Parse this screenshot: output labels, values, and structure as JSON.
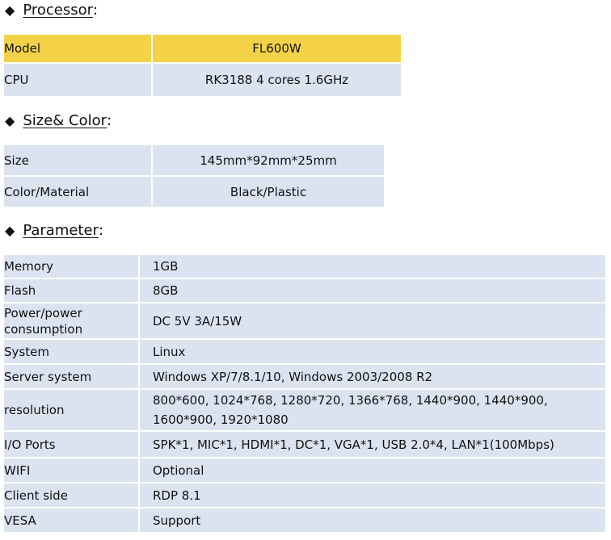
{
  "sections": {
    "processor": {
      "title": "Processor",
      "colon": ":"
    },
    "size_color": {
      "title": "Size& Color",
      "colon": ":"
    },
    "parameter": {
      "title": "Parameter",
      "colon": ":"
    }
  },
  "bullet": "◆",
  "processor_rows": [
    {
      "key": "Model",
      "value": "FL600W"
    },
    {
      "key": "CPU",
      "value": "RK3188 4 cores 1.6GHz"
    }
  ],
  "size_rows": [
    {
      "key": "Size",
      "value": "145mm*92mm*25mm"
    },
    {
      "key": "Color/Material",
      "value": "Black/Plastic"
    }
  ],
  "param_rows": [
    {
      "key": "Memory",
      "value": "1GB"
    },
    {
      "key": "Flash",
      "value": "8GB"
    },
    {
      "key": "Power/power consumption",
      "value": "DC 5V 3A/15W"
    },
    {
      "key": "System",
      "value": "Linux"
    },
    {
      "key": "Server system",
      "value": "Windows XP/7/8.1/10,  Windows 2003/2008 R2"
    },
    {
      "key": "resolution",
      "value": "800*600,  1024*768, 1280*720, 1366*768, 1440*900,  1440*900, 1600*900, 1920*1080"
    },
    {
      "key": "I/O Ports",
      "value": "SPK*1,  MIC*1,  HDMI*1, DC*1, VGA*1,  USB 2.0*4,  LAN*1(100Mbps)"
    },
    {
      "key": "WIFI",
      "value": "Optional"
    },
    {
      "key": "Client side",
      "value": "RDP 8.1"
    },
    {
      "key": "VESA",
      "value": "Support"
    }
  ]
}
